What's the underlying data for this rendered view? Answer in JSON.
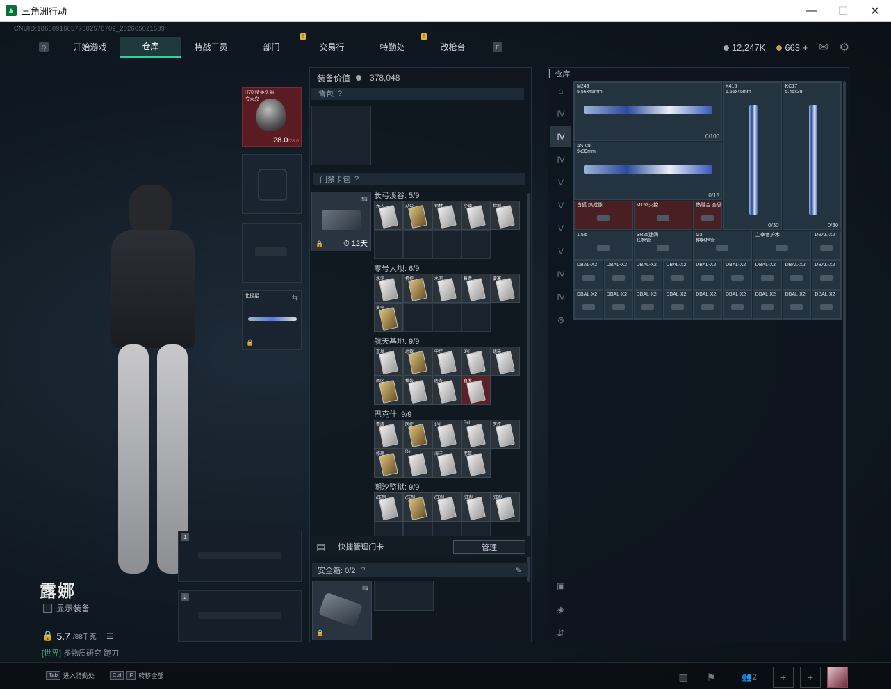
{
  "window": {
    "title": "三角洲行动"
  },
  "uid": "CNUID:186609160577502578702_202605021539",
  "nav": {
    "tabs": [
      "开始游戏",
      "仓库",
      "特战干员",
      "部门",
      "交易行",
      "特勤处",
      "改枪台"
    ],
    "active": 1,
    "badges": [
      3,
      5
    ]
  },
  "currency": {
    "silver": "12,247K",
    "gold": "663",
    "plus": "+"
  },
  "equip": {
    "helmet_label": "H70 精英头盔\n哈夫克",
    "helmet_val": "28.0",
    "helmet_max": "/28.0",
    "melee_label": "北极星"
  },
  "char": {
    "name": "露娜",
    "show_equip": "显示装备",
    "weight": "5.7",
    "weight_max": "/88千克",
    "world_tag": "[世界]",
    "world_rest": "多物质研究  跑刀"
  },
  "weapon_slots": [
    "1",
    "2"
  ],
  "mid": {
    "value_label": "装备价值",
    "value": "378,048",
    "backpack": "背包",
    "keycase": "门禁卡包",
    "keycase_timer": "12天",
    "quick_manage": "快捷管理门卡",
    "manage_btn": "管理",
    "safebox": "安全箱: 0/2"
  },
  "maps": [
    {
      "name": "长弓溪谷: 5/9",
      "cards": [
        "无人",
        "办公",
        "钢材",
        "小镇",
        "检测"
      ]
    },
    {
      "name": "零号大坝: 6/9",
      "cards": [
        "水泥",
        "机控",
        "水泥",
        "售票",
        "要塞",
        "变电"
      ]
    },
    {
      "name": "航天基地: 9/9",
      "cards": [
        "直发",
        "总裁",
        "中控",
        "3号",
        "组装",
        "西区",
        "横装",
        "医务",
        "直发"
      ]
    },
    {
      "name": "巴克什: 9/9",
      "cards": [
        "董店",
        "医疗",
        "1号",
        "Rel",
        "医疗",
        "修理",
        "Rel",
        "海洋",
        "老鼠"
      ]
    },
    {
      "name": "潮汐监狱: 9/9",
      "cards": [
        "(压制",
        "(压制",
        "(压制",
        "(压制",
        "(压制"
      ]
    }
  ],
  "stash": {
    "title": "仓库",
    "items": [
      {
        "name": "M249\n5.56x45mm",
        "count": "0/100"
      },
      {
        "name": "K416\n5.56x45mm",
        "count": "0/30"
      },
      {
        "name": "KC17\n5.45x39",
        "count": "0/30"
      },
      {
        "name": "AS Val\n9x39mm",
        "count": "0/15"
      },
      {
        "name": "白狐 热成像",
        "count": ""
      },
      {
        "name": "M157火控",
        "count": ""
      },
      {
        "name": "热融合 全息",
        "count": ""
      },
      {
        "name": "1.5/5",
        "count": ""
      },
      {
        "name": "SR25迷间\n长枪管",
        "count": ""
      },
      {
        "name": "G3\n伸射枪管",
        "count": ""
      },
      {
        "name": "主宰者护木",
        "count": ""
      },
      {
        "name": "DBAL-X2",
        "count": ""
      }
    ],
    "dbal_label": "DBAL-X2"
  },
  "bottom": {
    "hint1_key": "Tab",
    "hint1": "进入特勤处",
    "hint2_key1": "Ctrl",
    "hint2_key2": "F",
    "hint2": "转移全部",
    "squad": "2"
  }
}
